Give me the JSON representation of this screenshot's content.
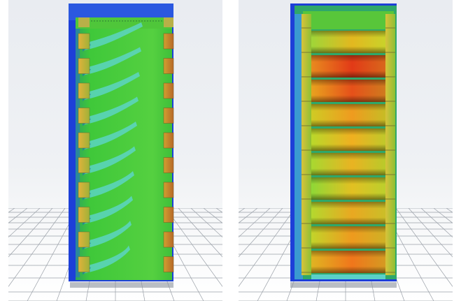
{
  "figure": {
    "panels": [
      {
        "id": "velocity-panel",
        "colors": {
          "frame": "#1d3fd8",
          "flow": "#3fc83a",
          "wake": "#5fd6d6",
          "module": "#c7a53a"
        },
        "module_count": 10
      },
      {
        "id": "temperature-panel",
        "colors": {
          "frame": "#1d3fd8",
          "hot": "#e83a1a",
          "warm": "#f0a020",
          "cool": "#7fd630",
          "module": "#c7a53a"
        },
        "cell_count": 10
      }
    ]
  }
}
